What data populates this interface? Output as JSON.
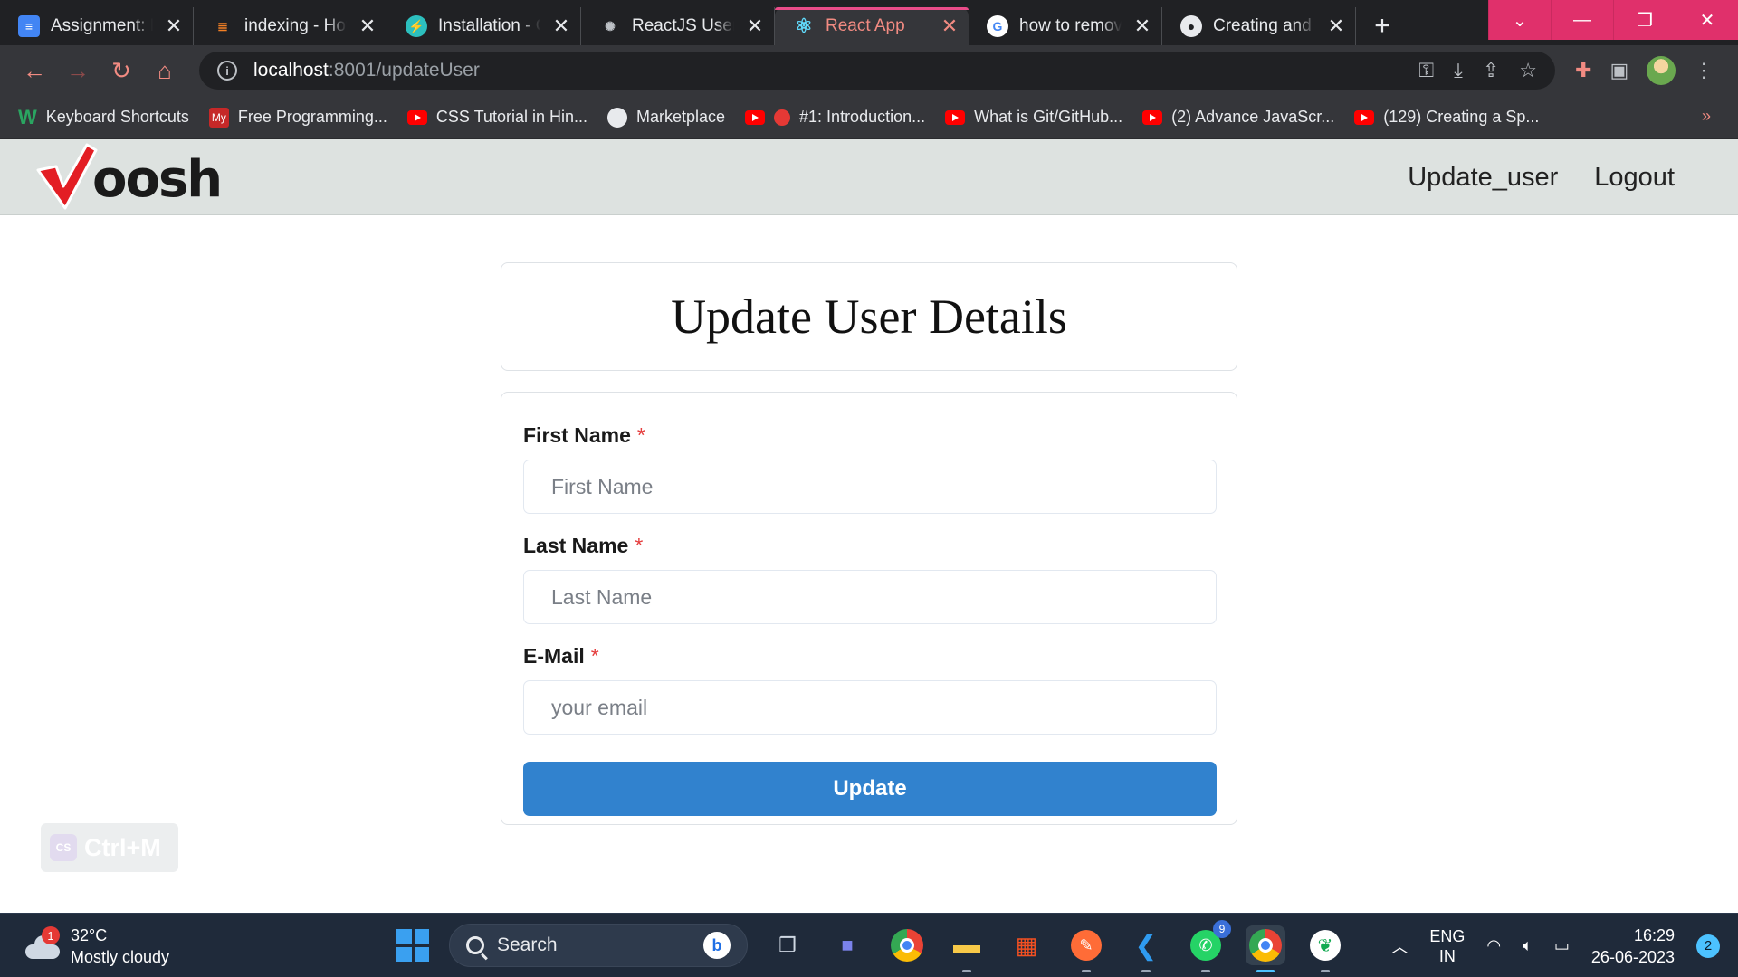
{
  "browser": {
    "tabs": [
      {
        "title": "Assignment: Fu",
        "icon": "google-docs-icon",
        "color": "#4285f4",
        "glyph": "≡"
      },
      {
        "title": "indexing - How",
        "icon": "stackoverflow-icon",
        "color": "#f48024",
        "glyph": "S"
      },
      {
        "title": "Installation - Ch",
        "icon": "chakra-icon",
        "color": "#2cbfbe",
        "glyph": "⚡"
      },
      {
        "title": "ReactJS User U",
        "icon": "chatgpt-icon",
        "color": "#74aa9c",
        "glyph": "✺"
      },
      {
        "title": "React App",
        "icon": "react-icon",
        "color": "#35363a",
        "glyph": "⚛",
        "active": true
      },
      {
        "title": "how to remove",
        "icon": "google-icon",
        "color": "#ffffff",
        "glyph": "G"
      },
      {
        "title": "Creating and h",
        "icon": "github-icon",
        "color": "#e8eaed",
        "glyph": "●"
      }
    ],
    "url_host": "localhost",
    "url_path": ":8001/updateUser",
    "bookmarks": [
      {
        "label": "Keyboard Shortcuts",
        "icon": "w-icon"
      },
      {
        "label": "Free Programming...",
        "icon": "my-icon"
      },
      {
        "label": "CSS Tutorial in Hin...",
        "icon": "youtube-icon"
      },
      {
        "label": "Marketplace",
        "icon": "github-icon"
      },
      {
        "label": "#1: Introduction...",
        "icon": "youtube-icon"
      },
      {
        "label": "What is Git/GitHub...",
        "icon": "youtube-icon"
      },
      {
        "label": "(2) Advance JavaScr...",
        "icon": "youtube-icon"
      },
      {
        "label": "(129) Creating a Sp...",
        "icon": "youtube-icon"
      }
    ],
    "accent_color": "#e0306b"
  },
  "app": {
    "logo_text": "oosh",
    "nav": {
      "update_user": "Update_user",
      "logout": "Logout"
    },
    "title": "Update User Details",
    "form": {
      "first_name_label": "First Name",
      "first_name_placeholder": "First Name",
      "first_name_value": "",
      "last_name_label": "Last Name",
      "last_name_placeholder": "Last Name",
      "last_name_value": "",
      "email_label": "E-Mail",
      "email_placeholder": "your email",
      "email_value": "",
      "required_marker": "*",
      "submit_label": "Update",
      "submit_color": "#3182ce"
    },
    "extension_overlay": {
      "label": "Ctrl+M",
      "icon_text": "CS"
    }
  },
  "taskbar": {
    "weather_temp": "32°C",
    "weather_desc": "Mostly cloudy",
    "weather_badge": "1",
    "search_placeholder": "Search",
    "whatsapp_badge": "9",
    "lang_line1": "ENG",
    "lang_line2": "IN",
    "time": "16:29",
    "date": "26-06-2023",
    "notification_count": "2"
  }
}
